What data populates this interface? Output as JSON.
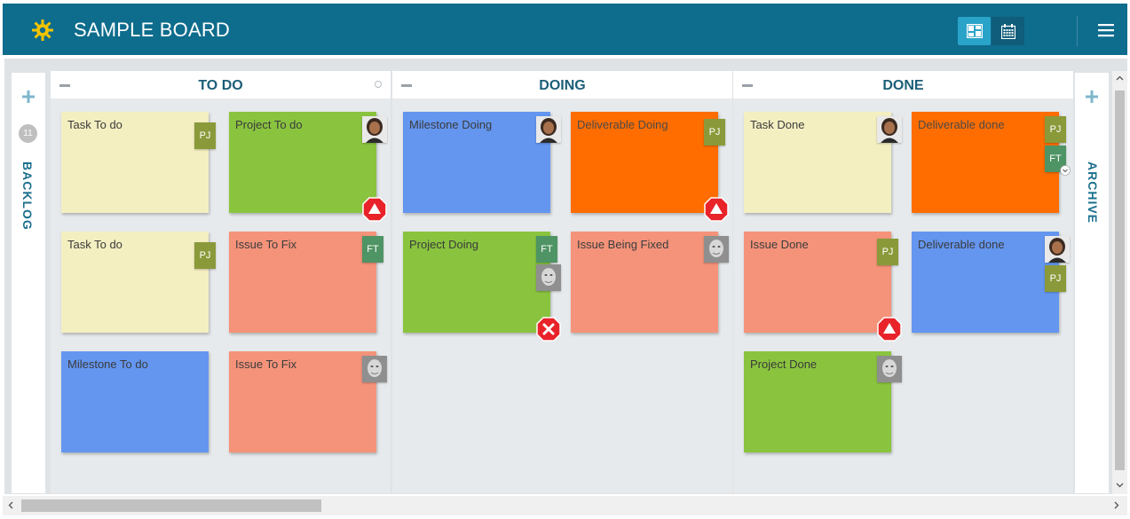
{
  "header": {
    "title": "SAMPLE BOARD",
    "logo_icon": "gear-icon",
    "view_board_icon": "board-view-icon",
    "view_calendar_icon": "calendar-icon",
    "menu_icon": "hamburger-menu-icon",
    "bg_color": "#0e6c8c"
  },
  "backlog": {
    "label": "BACKLOG",
    "count": "11"
  },
  "archive": {
    "label": "ARCHIVE"
  },
  "columns": [
    {
      "title": "TO DO",
      "cards": [
        {
          "title": "Task To do",
          "color": "yellow",
          "badges": [
            "PJ"
          ]
        },
        {
          "title": "Project To do",
          "color": "green",
          "badges": [
            "avatar-woman"
          ],
          "alert": "warning"
        },
        {
          "title": "Task To do",
          "color": "yellow",
          "badges": [
            "PJ"
          ]
        },
        {
          "title": "Issue To Fix",
          "color": "salmon",
          "badges": [
            "FT"
          ]
        },
        {
          "title": "Milestone To do",
          "color": "blue",
          "badges": []
        },
        {
          "title": "Issue To Fix",
          "color": "salmon",
          "badges": [
            "avatar-man"
          ]
        }
      ]
    },
    {
      "title": "DOING",
      "cards": [
        {
          "title": "Milestone Doing",
          "color": "blue",
          "badges": [
            "avatar-woman"
          ]
        },
        {
          "title": "Deliverable Doing",
          "color": "orange",
          "badges": [
            "PJ"
          ],
          "alert": "warning"
        },
        {
          "title": "Project Doing",
          "color": "green",
          "badges": [
            "FT",
            "avatar-man"
          ],
          "alert": "error"
        },
        {
          "title": "Issue Being Fixed",
          "color": "salmon",
          "badges": [
            "avatar-man"
          ]
        }
      ]
    },
    {
      "title": "DONE",
      "cards": [
        {
          "title": "Task Done",
          "color": "yellow",
          "badges": [
            "avatar-woman"
          ]
        },
        {
          "title": "Deliverable done",
          "color": "orange",
          "badges": [
            "PJ",
            "FT"
          ]
        },
        {
          "title": "Issue Done",
          "color": "salmon",
          "badges": [
            "PJ"
          ],
          "alert": "warning"
        },
        {
          "title": "Deliverable done",
          "color": "blue",
          "badges": [
            "avatar-woman",
            "PJ"
          ]
        },
        {
          "title": "Project Done",
          "color": "green",
          "badges": [
            "avatar-man"
          ]
        }
      ]
    }
  ],
  "badge_labels": {
    "pj": "PJ",
    "ft": "FT"
  },
  "colors": {
    "yellow": "#f4efc1",
    "green": "#8ac43f",
    "salmon": "#f4937a",
    "blue": "#6496f0",
    "orange": "#ff6d00",
    "alert_red": "#e8232a"
  }
}
